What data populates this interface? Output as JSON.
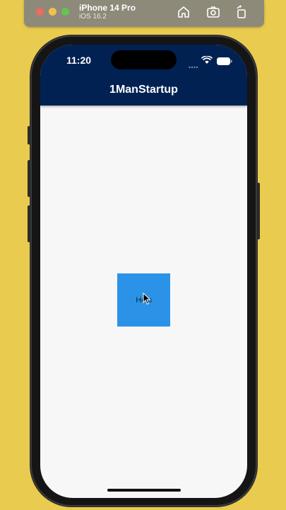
{
  "simulator": {
    "device_name": "iPhone 14 Pro",
    "os_version": "iOS 16.2",
    "tools": [
      "home-icon",
      "screenshot-icon",
      "rotate-icon"
    ]
  },
  "status_bar": {
    "time": "11:20"
  },
  "app_bar": {
    "title": "1ManStartup",
    "background_color": "#002152"
  },
  "main": {
    "help_button_label": "Help",
    "help_button_color": "#2a93e7"
  }
}
